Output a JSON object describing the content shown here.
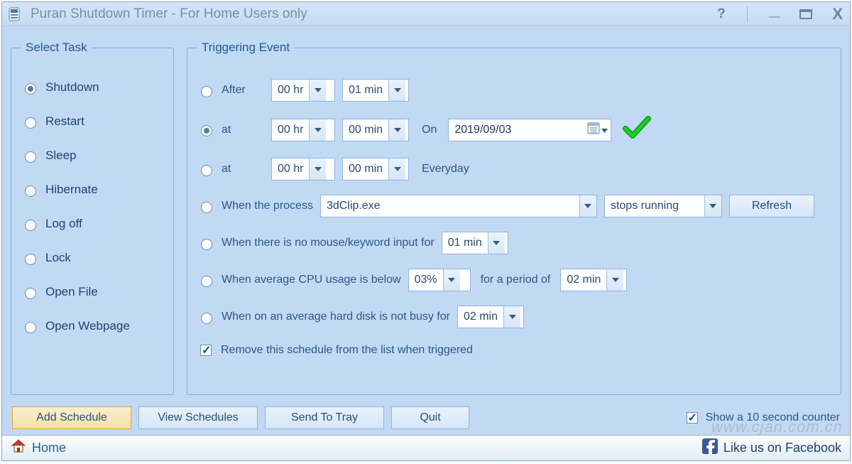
{
  "window": {
    "title": "Puran Shutdown Timer - For Home Users only"
  },
  "groups": {
    "select_task": "Select Task",
    "triggering_event": "Triggering Event"
  },
  "tasks": [
    "Shutdown",
    "Restart",
    "Sleep",
    "Hibernate",
    "Log off",
    "Lock",
    "Open File",
    "Open Webpage"
  ],
  "task_selected": 0,
  "trigger": {
    "radio_labels": {
      "after": "After",
      "at1": "at",
      "at2": "at",
      "process": "When the process",
      "idle": "When there is no mouse/keyword input for",
      "cpu": "When average CPU usage is below",
      "disk": "When on an average hard disk is not busy for"
    },
    "after": {
      "hr": "00 hr",
      "min": "01 min"
    },
    "at1": {
      "hr": "00 hr",
      "min": "00 min",
      "on_label": "On",
      "date": "2019/09/03"
    },
    "at2": {
      "hr": "00 hr",
      "min": "00 min",
      "everyday": "Everyday"
    },
    "process_selected": "3dClip.exe",
    "process_action": "stops running",
    "refresh": "Refresh",
    "idle_min": "01 min",
    "cpu_pct": "03%",
    "cpu_for_label": "for a period of",
    "cpu_period": "02 min",
    "disk_period": "02 min",
    "remove_label": "Remove this schedule from the list when triggered",
    "remove_checked": true,
    "selected_index": 1
  },
  "buttons": {
    "add": "Add Schedule",
    "view": "View Schedules",
    "tray": "Send To Tray",
    "quit": "Quit"
  },
  "options": {
    "counter_label": "Show a 10 second counter",
    "counter_checked": true
  },
  "status": {
    "home": "Home",
    "facebook": "Like us on Facebook"
  },
  "watermark": "www.cjan.com.cn"
}
